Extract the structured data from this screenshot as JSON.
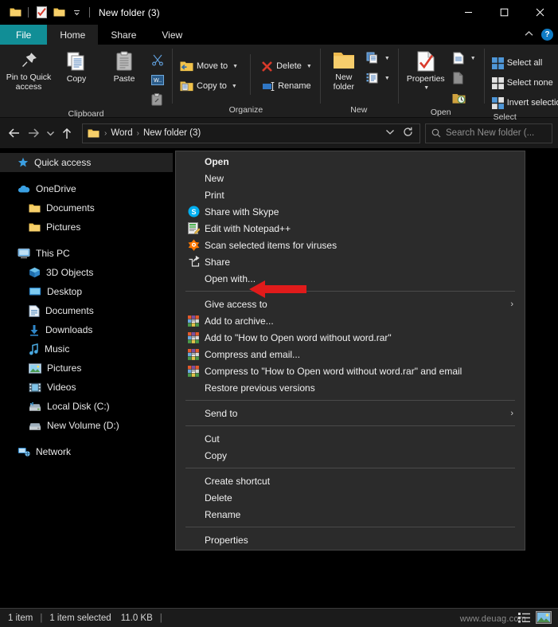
{
  "window": {
    "title": "New folder (3)",
    "quick_access_icons": [
      "folder-icon",
      "properties-icon",
      "new-folder-icon",
      "customize-qat-caret"
    ],
    "controls": {
      "minimize": "—",
      "maximize": "☐",
      "close": "✕"
    }
  },
  "ribbon": {
    "tabs": [
      {
        "label": "File",
        "accent": "#118e96",
        "active": false
      },
      {
        "label": "Home",
        "active": true
      },
      {
        "label": "Share",
        "active": false
      },
      {
        "label": "View",
        "active": false
      }
    ],
    "collapse_caret": "⌃",
    "help_label": "?",
    "groups": [
      {
        "name": "Clipboard",
        "big": [
          {
            "label": "Pin to Quick\naccess",
            "line1": "Pin to Quick",
            "line2": "access",
            "icon": "pin-icon"
          },
          {
            "label": "Copy",
            "line1": "Copy",
            "line2": "",
            "icon": "copy-icon"
          },
          {
            "label": "Paste",
            "line1": "Paste",
            "line2": "",
            "icon": "paste-icon"
          }
        ],
        "small": [
          {
            "label": "",
            "icon": "cut-scissors-icon"
          },
          {
            "label": "",
            "icon": "copy-path-icon"
          },
          {
            "label": "",
            "icon": "paste-shortcut-icon"
          }
        ]
      },
      {
        "name": "Organize",
        "small": [
          {
            "label": "Move to",
            "icon": "move-to-icon",
            "caret": true
          },
          {
            "label": "Copy to",
            "icon": "copy-to-icon",
            "caret": true
          },
          {
            "label": "Delete",
            "icon": "delete-x-icon",
            "caret": true
          },
          {
            "label": "Rename",
            "icon": "rename-icon",
            "caret": false
          }
        ]
      },
      {
        "name": "New",
        "big": [
          {
            "line1": "New",
            "line2": "folder",
            "icon": "new-folder-icon"
          }
        ],
        "small": [
          {
            "label": "",
            "icon": "new-item-icon",
            "caret": true
          },
          {
            "label": "",
            "icon": "easy-access-icon",
            "caret": true
          }
        ]
      },
      {
        "name": "Open",
        "big": [
          {
            "line1": "Properties",
            "line2": "",
            "icon": "properties-icon",
            "caret": true
          }
        ],
        "small": [
          {
            "label": "",
            "icon": "open-icon",
            "caret": true
          },
          {
            "label": "",
            "icon": "edit-icon",
            "caret": false
          },
          {
            "label": "",
            "icon": "history-icon",
            "caret": false
          }
        ]
      },
      {
        "name": "Select",
        "small": [
          {
            "label": "Select all",
            "icon": "select-all-icon",
            "caret": false
          },
          {
            "label": "Select none",
            "icon": "select-none-icon",
            "caret": false
          },
          {
            "label": "Invert selection",
            "icon": "invert-selection-icon",
            "caret": false
          }
        ]
      }
    ]
  },
  "addressbar": {
    "back_icon": "back-arrow-icon",
    "forward_icon": "forward-arrow-icon",
    "recent_icon": "chevron-down-icon",
    "up_icon": "up-arrow-icon",
    "breadcrumbs": [
      "Word",
      "New folder (3)"
    ],
    "dropdown_icon": "chevron-down-icon",
    "refresh_icon": "refresh-icon",
    "search": {
      "icon": "search-icon",
      "placeholder": "Search New folder (...",
      "value": ""
    }
  },
  "navpane": {
    "items": [
      {
        "label": "Quick access",
        "icon": "star-icon",
        "indent": false,
        "selected": true
      },
      {
        "label": "",
        "icon": "",
        "spacer": true
      },
      {
        "label": "OneDrive",
        "icon": "cloud-icon",
        "indent": false,
        "selected": false
      },
      {
        "label": "Documents",
        "icon": "folder-icon",
        "indent": true,
        "selected": false
      },
      {
        "label": "Pictures",
        "icon": "folder-icon",
        "indent": true,
        "selected": false
      },
      {
        "label": "",
        "icon": "",
        "spacer": true
      },
      {
        "label": "This PC",
        "icon": "pc-icon",
        "indent": false,
        "selected": false
      },
      {
        "label": "3D Objects",
        "icon": "cube-icon",
        "indent": true,
        "selected": false
      },
      {
        "label": "Desktop",
        "icon": "desktop-icon",
        "indent": true,
        "selected": false
      },
      {
        "label": "Documents",
        "icon": "documents-icon",
        "indent": true,
        "selected": false
      },
      {
        "label": "Downloads",
        "icon": "download-icon",
        "indent": true,
        "selected": false
      },
      {
        "label": "Music",
        "icon": "music-note-icon",
        "indent": true,
        "selected": false
      },
      {
        "label": "Pictures",
        "icon": "pictures-icon",
        "indent": true,
        "selected": false
      },
      {
        "label": "Videos",
        "icon": "videos-icon",
        "indent": true,
        "selected": false
      },
      {
        "label": "Local Disk (C:)",
        "icon": "disk-icon",
        "indent": true,
        "selected": false
      },
      {
        "label": "New Volume (D:)",
        "icon": "disk-icon",
        "indent": true,
        "selected": false
      },
      {
        "label": "",
        "icon": "",
        "spacer": true
      },
      {
        "label": "Network",
        "icon": "network-icon",
        "indent": false,
        "selected": false
      }
    ]
  },
  "content": {
    "file": {
      "name": "",
      "icon": "word-document-icon",
      "selected": true
    }
  },
  "context_menu": {
    "items": [
      {
        "label": "Open",
        "icon": "",
        "bold": true,
        "type": "item"
      },
      {
        "label": "New",
        "icon": "",
        "bold": false,
        "type": "item"
      },
      {
        "label": "Print",
        "icon": "",
        "bold": false,
        "type": "item"
      },
      {
        "label": "Share with Skype",
        "icon": "skype-icon",
        "bold": false,
        "type": "item"
      },
      {
        "label": "Edit with Notepad++",
        "icon": "notepadpp-icon",
        "bold": false,
        "type": "item"
      },
      {
        "label": "Scan selected items for viruses",
        "icon": "avast-icon",
        "bold": false,
        "type": "item"
      },
      {
        "label": "Share",
        "icon": "share-icon",
        "bold": false,
        "type": "item"
      },
      {
        "label": "Open with...",
        "icon": "",
        "bold": false,
        "type": "item",
        "annotated": true
      },
      {
        "type": "separator"
      },
      {
        "label": "Give access to",
        "icon": "",
        "bold": false,
        "type": "item",
        "submenu": "›"
      },
      {
        "label": "Add to archive...",
        "icon": "winrar-icon",
        "bold": false,
        "type": "item"
      },
      {
        "label": "Add to \"How to Open word without word.rar\"",
        "icon": "winrar-icon",
        "bold": false,
        "type": "item"
      },
      {
        "label": "Compress and email...",
        "icon": "winrar-icon",
        "bold": false,
        "type": "item"
      },
      {
        "label": "Compress to \"How to Open word without word.rar\" and email",
        "icon": "winrar-icon",
        "bold": false,
        "type": "item"
      },
      {
        "label": "Restore previous versions",
        "icon": "",
        "bold": false,
        "type": "item"
      },
      {
        "type": "separator"
      },
      {
        "label": "Send to",
        "icon": "",
        "bold": false,
        "type": "item",
        "submenu": "›"
      },
      {
        "type": "separator"
      },
      {
        "label": "Cut",
        "icon": "",
        "bold": false,
        "type": "item"
      },
      {
        "label": "Copy",
        "icon": "",
        "bold": false,
        "type": "item"
      },
      {
        "type": "separator"
      },
      {
        "label": "Create shortcut",
        "icon": "",
        "bold": false,
        "type": "item"
      },
      {
        "label": "Delete",
        "icon": "",
        "bold": false,
        "type": "item"
      },
      {
        "label": "Rename",
        "icon": "",
        "bold": false,
        "type": "item"
      },
      {
        "type": "separator"
      },
      {
        "label": "Properties",
        "icon": "",
        "bold": false,
        "type": "item"
      }
    ],
    "annotation": {
      "type": "arrow",
      "color": "#e01b1b",
      "points_to": "Open with..."
    }
  },
  "statusbar": {
    "item_count": "1 item",
    "selection": "1 item selected",
    "size": "11.0 KB",
    "separator": "|",
    "watermark": "www.deuag.com",
    "view_icons": [
      "details-view-icon",
      "large-icons-view-icon"
    ]
  },
  "colors": {
    "accent_teal": "#118e96",
    "menu_bg": "#2b2b2b",
    "window_bg": "#000000",
    "ribbon_bg": "#1f1f1f",
    "annotation_red": "#e01b1b",
    "folder_yellow": "#f7ca63",
    "link_blue": "#0f7bc4"
  }
}
